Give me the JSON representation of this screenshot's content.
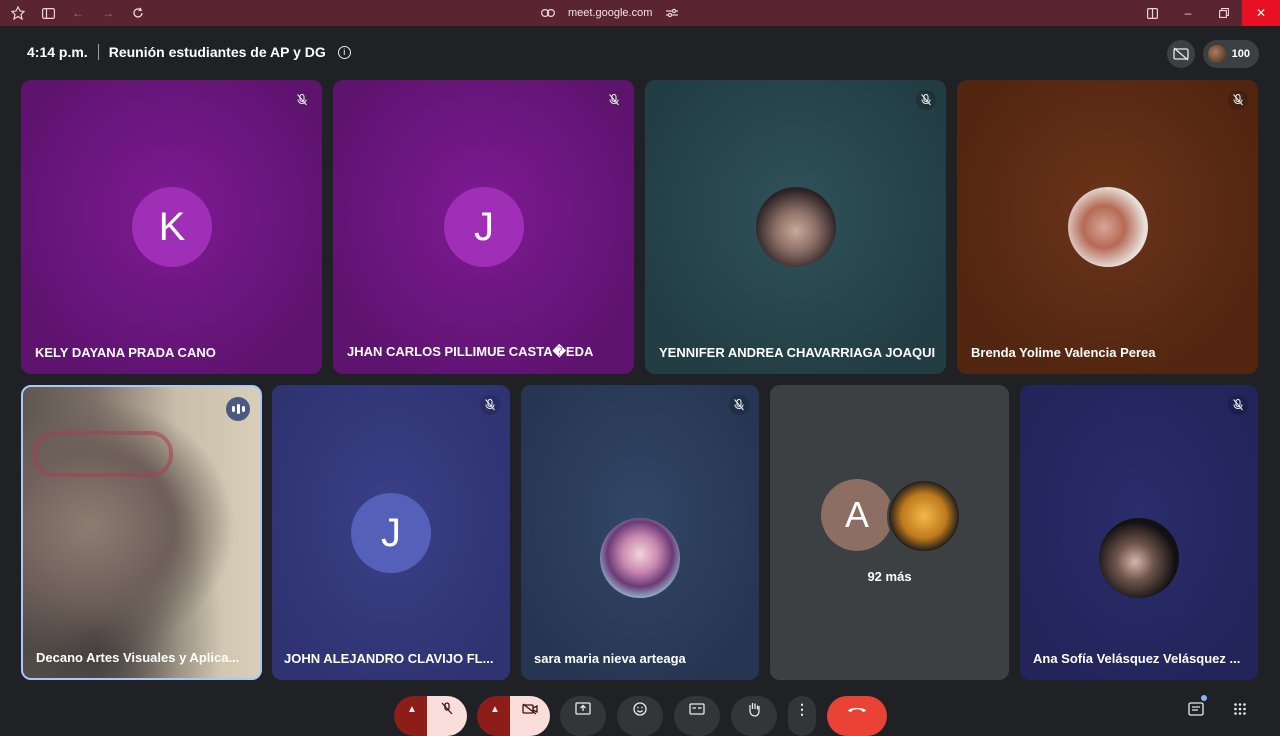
{
  "browser": {
    "url": "meet.google.com"
  },
  "meeting": {
    "time": "4:14 p.m.",
    "title": "Reunión estudiantes de AP y DG",
    "participants_count": "100"
  },
  "tiles_row1": [
    {
      "name": "KELY DAYANA PRADA CANO",
      "initial": "K"
    },
    {
      "name": "JHAN CARLOS PILLIMUE CASTA�EDA",
      "initial": "J"
    },
    {
      "name": "YENNIFER ANDREA CHAVARRIAGA JOAQUI",
      "initial": ""
    },
    {
      "name": "Brenda Yolime Valencia Perea",
      "initial": ""
    }
  ],
  "tiles_row2": [
    {
      "name": "Decano Artes Visuales y Aplica...",
      "initial": ""
    },
    {
      "name": "JOHN ALEJANDRO CLAVIJO FL...",
      "initial": "J"
    },
    {
      "name": "sara maria nieva arteaga",
      "initial": ""
    },
    {
      "name": "",
      "initial": "A",
      "more": "92 más"
    },
    {
      "name": "Ana Sofía Velásquez Velásquez ...",
      "initial": ""
    }
  ],
  "colors": {
    "chrome_bg": "#5a2531",
    "meet_bg": "#202124",
    "purple_tile": "#6f1a86",
    "teal_tile": "#28464d",
    "brown_tile": "#5a2a14",
    "blue_tile": "#36397e",
    "grey_tile": "#3c4043",
    "end_call": "#ea4335"
  }
}
